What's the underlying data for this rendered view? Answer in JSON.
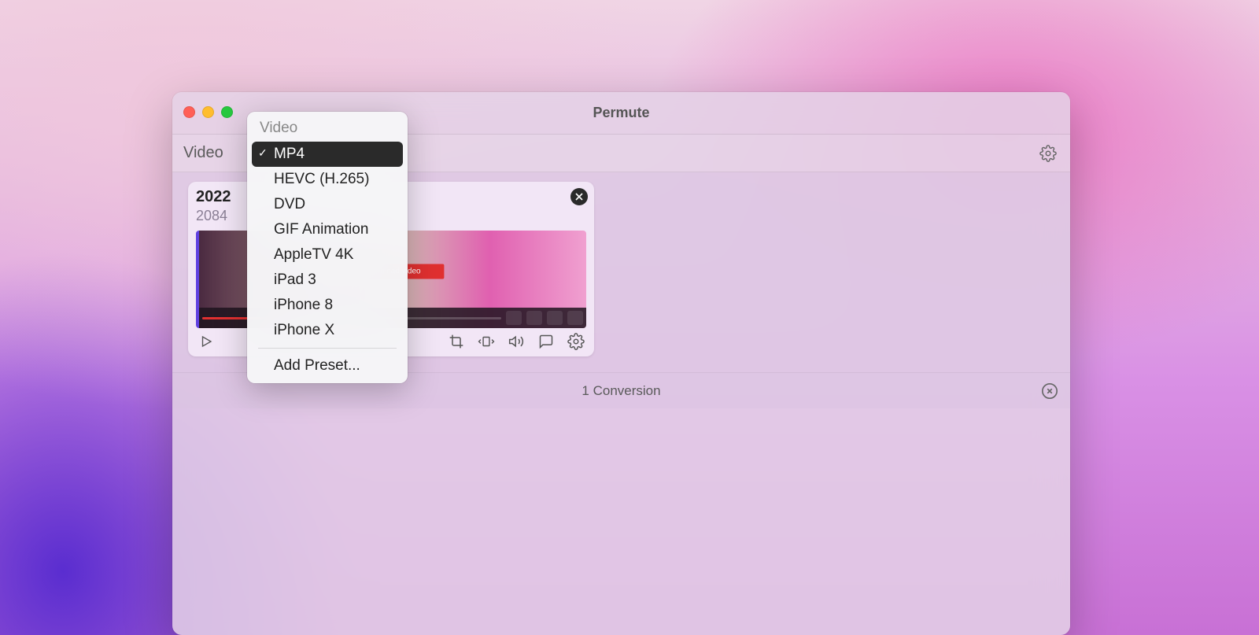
{
  "window": {
    "title": "Permute"
  },
  "toolbar": {
    "category_label": "Video"
  },
  "dropdown": {
    "header": "Video",
    "items": [
      {
        "label": "MP4",
        "selected": true
      },
      {
        "label": "HEVC (H.265)",
        "selected": false
      },
      {
        "label": "DVD",
        "selected": false
      },
      {
        "label": "GIF Animation",
        "selected": false
      },
      {
        "label": "AppleTV 4K",
        "selected": false
      },
      {
        "label": "iPad 3",
        "selected": false
      },
      {
        "label": "iPhone 8",
        "selected": false
      },
      {
        "label": "iPhone X",
        "selected": false
      }
    ],
    "add_preset": "Add Preset..."
  },
  "card": {
    "title_visible": "2022",
    "subtitle_visible": "2084",
    "thumb_button": "Download video"
  },
  "status": {
    "text": "1 Conversion"
  }
}
